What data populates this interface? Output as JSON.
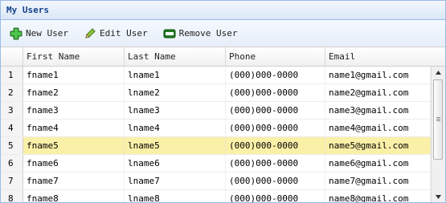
{
  "panel": {
    "title": "My Users"
  },
  "toolbar": {
    "new_label": "New User",
    "edit_label": "Edit User",
    "remove_label": "Remove User"
  },
  "columns": [
    "First Name",
    "Last Name",
    "Phone",
    "Email"
  ],
  "selected_row": 5,
  "rows": [
    {
      "num": "1",
      "first": "fname1",
      "last": "lname1",
      "phone": "(000)000-0000",
      "email": "name1@gmail.com"
    },
    {
      "num": "2",
      "first": "fname2",
      "last": "lname2",
      "phone": "(000)000-0000",
      "email": "name2@gmail.com"
    },
    {
      "num": "3",
      "first": "fname3",
      "last": "lname3",
      "phone": "(000)000-0000",
      "email": "name3@gmail.com"
    },
    {
      "num": "4",
      "first": "fname4",
      "last": "lname4",
      "phone": "(000)000-0000",
      "email": "name4@gmail.com"
    },
    {
      "num": "5",
      "first": "fname5",
      "last": "lname5",
      "phone": "(000)000-0000",
      "email": "name5@gmail.com"
    },
    {
      "num": "6",
      "first": "fname6",
      "last": "lname6",
      "phone": "(000)000-0000",
      "email": "name6@gmail.com"
    },
    {
      "num": "7",
      "first": "fname7",
      "last": "lname7",
      "phone": "(000)000-0000",
      "email": "name7@gmail.com"
    },
    {
      "num": "8",
      "first": "fname8",
      "last": "lname8",
      "phone": "(000)000-0000",
      "email": "name8@gmail.com"
    }
  ],
  "colors": {
    "accent": "#15428b",
    "border": "#99bbe8",
    "selected": "#fbf0a8"
  }
}
